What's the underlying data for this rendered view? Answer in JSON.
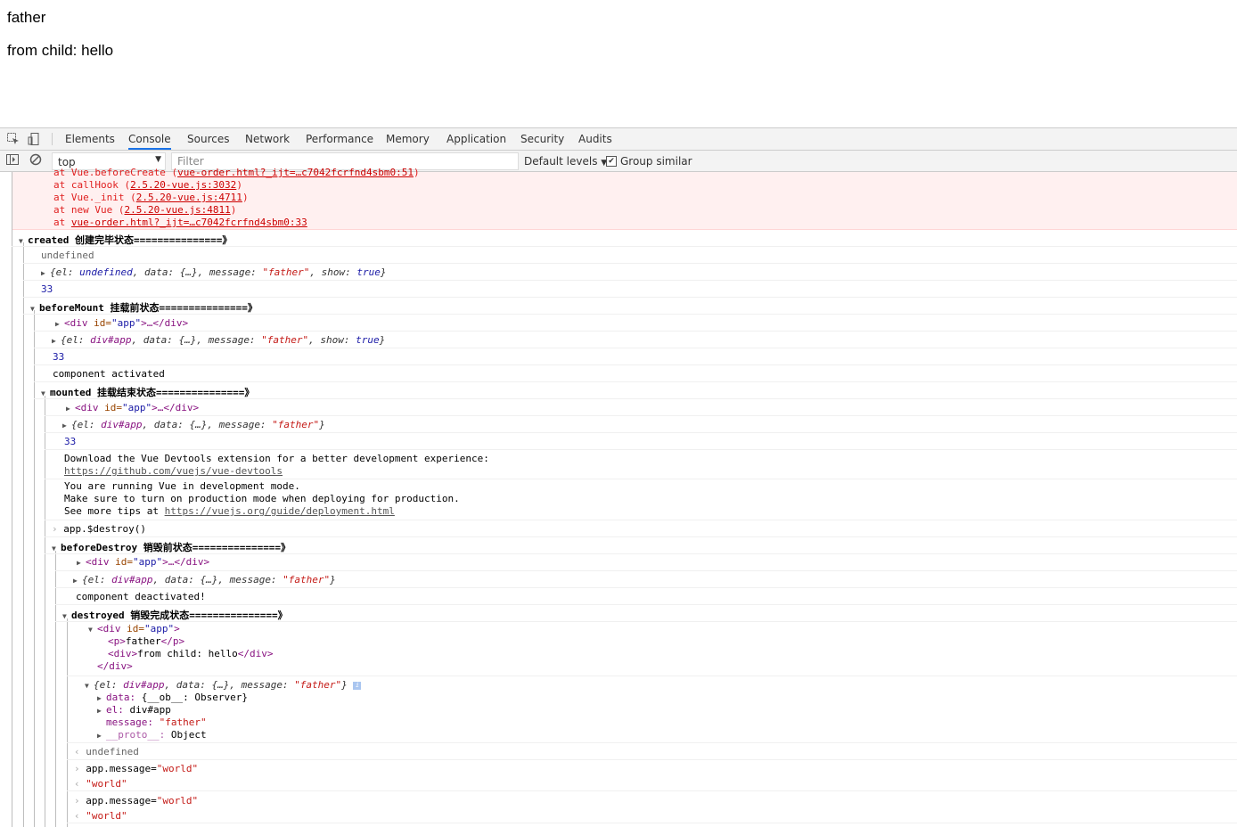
{
  "page": {
    "line1": "father",
    "line2": "from child: hello"
  },
  "devtools": {
    "tabs": [
      "Elements",
      "Console",
      "Sources",
      "Network",
      "Performance",
      "Memory",
      "Application",
      "Security",
      "Audits"
    ],
    "active_tab": "Console",
    "context": "top",
    "filter_placeholder": "Filter",
    "levels": "Default levels",
    "group_similar": "Group similar",
    "accent_color": "#1a73e8"
  },
  "console": {
    "error": {
      "lines": [
        {
          "prefix": "at Vue.beforeCreate (",
          "link": "vue-order.html?_ijt=…c7042fcrfnd4sbm0:51",
          "suffix": ")"
        },
        {
          "prefix": "at callHook (",
          "link": "2.5.20-vue.js:3032",
          "suffix": ")"
        },
        {
          "prefix": "at Vue._init (",
          "link": "2.5.20-vue.js:4711",
          "suffix": ")"
        },
        {
          "prefix": "at new Vue (",
          "link": "2.5.20-vue.js:4811",
          "suffix": ")"
        },
        {
          "prefix": "at ",
          "link": "vue-order.html?_ijt=…c7042fcrfnd4sbm0:33",
          "suffix": ""
        }
      ]
    },
    "created": {
      "title_a": "created",
      "title_b": "创建完毕状态===============》",
      "undefined": "undefined",
      "obj": {
        "a": "{el: ",
        "b": "undefined",
        "c": ", data: {…}, message: ",
        "d": "\"father\"",
        "e": ", show: ",
        "f": "true",
        "g": "}"
      },
      "num": "33"
    },
    "beforeMount": {
      "title_a": "beforeMount",
      "title_b": "挂载前状态===============》",
      "div_open": "<div",
      "div_attr": " id=",
      "div_val": "\"app\"",
      "div_rest": ">…</div>",
      "obj": {
        "a": "{el: ",
        "b": "div#app",
        "c": ", data: {…}, message: ",
        "d": "\"father\"",
        "e": ", show: ",
        "f": "true",
        "g": "}"
      },
      "num": "33",
      "activated": "component activated"
    },
    "mounted": {
      "title_a": "mounted",
      "title_b": "挂载结束状态===============》",
      "obj": {
        "a": "{el: ",
        "b": "div#app",
        "c": ", data: {…}, message: ",
        "d": "\"father\"",
        "g": "}"
      },
      "num": "33",
      "devtools_msg": "Download the Vue Devtools extension for a better development experience:",
      "devtools_link": "https://github.com/vuejs/vue-devtools",
      "dev1": "You are running Vue in development mode.",
      "dev2": "Make sure to turn on production mode when deploying for production.",
      "dev3_prefix": "See more tips at ",
      "dev3_link": "https://vuejs.org/guide/deployment.html",
      "destroy_cmd": "app.$destroy()"
    },
    "beforeDestroy": {
      "title_a": "beforeDestroy",
      "title_b": "销毁前状态===============》",
      "obj": {
        "a": "{el: ",
        "b": "div#app",
        "c": ", data: {…}, message: ",
        "d": "\"father\"",
        "g": "}"
      },
      "deactivated": "component deactivated!"
    },
    "destroyed": {
      "title_a": "destroyed",
      "title_b": "销毁完成状态===============》",
      "dom": {
        "l1_tag": "<div",
        "l1_attr": " id=",
        "l1_val": "\"app\"",
        "l1_end": ">",
        "l2_tag": "<p>",
        "l2_text": "father",
        "l2_end": "</p>",
        "l3_tag": "<div>",
        "l3_text": "from child: hello",
        "l3_end": "</div>",
        "l4": "</div>"
      },
      "obj": {
        "a": "{el: ",
        "b": "div#app",
        "c": ", data: {…}, message: ",
        "d": "\"father\"",
        "g": "}"
      },
      "props": {
        "data_k": "data:",
        "data_v": " {__ob__: Observer}",
        "el_k": "el:",
        "el_v": " div#app",
        "msg_k": "message:",
        "msg_v": " \"father\"",
        "proto_k": "__proto__:",
        "proto_v": " Object"
      }
    },
    "results": {
      "undefined": "undefined",
      "cmd1_a": "app.message=",
      "cmd1_b": "\"world\"",
      "res1": "\"world\"",
      "cmd2_a": "app.message=",
      "cmd2_b": "\"world\"",
      "res2": "\"world\""
    }
  }
}
